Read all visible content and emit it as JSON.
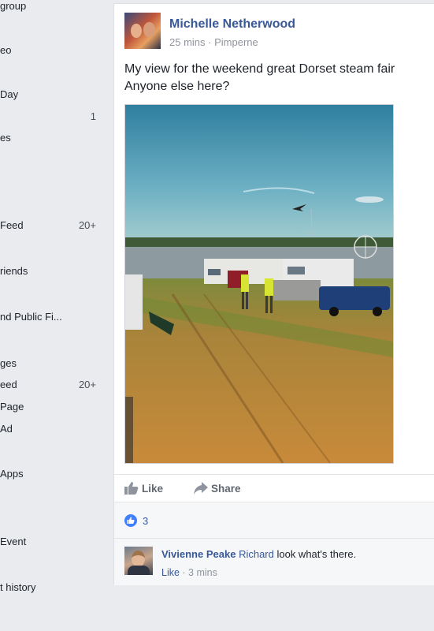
{
  "sidebar": {
    "items": [
      {
        "label": "group",
        "count": ""
      },
      {
        "label": "eo",
        "count": ""
      },
      {
        "label": "Day",
        "count": ""
      },
      {
        "label": "",
        "count": "1"
      },
      {
        "label": "es",
        "count": ""
      },
      {
        "label": "Feed",
        "count": "20+"
      },
      {
        "label": "riends",
        "count": ""
      },
      {
        "label": "nd Public Fi...",
        "count": ""
      },
      {
        "label": "ges",
        "count": ""
      },
      {
        "label": "eed",
        "count": "20+"
      },
      {
        "label": "Page",
        "count": ""
      },
      {
        "label": "Ad",
        "count": ""
      },
      {
        "label": " Apps",
        "count": ""
      },
      {
        "label": "Event",
        "count": ""
      },
      {
        "label": "t history",
        "count": ""
      }
    ]
  },
  "post": {
    "author": "Michelle Netherwood",
    "time": "25 mins",
    "separator": " · ",
    "location": "Pimperne",
    "text_line1": "My view for the weekend great Dorset steam fair",
    "text_line2": "Anyone else here?",
    "actions": {
      "like_label": "Like",
      "share_label": "Share"
    },
    "reactions": {
      "count": "3"
    },
    "comment": {
      "author": "Vivienne Peake",
      "mention": "Richard",
      "text": " look what's there.",
      "like_label": "Like",
      "separator": " · ",
      "time": "3 mins"
    }
  },
  "colors": {
    "link_blue": "#385898",
    "like_blue": "#4080ff",
    "page_bg": "#e9ebee"
  }
}
